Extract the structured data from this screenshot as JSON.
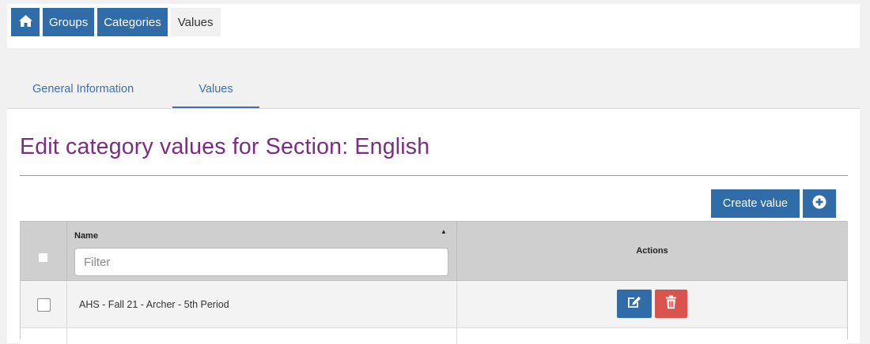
{
  "breadcrumb": {
    "home_icon": "home-icon",
    "items": [
      "Groups",
      "Categories"
    ],
    "current": "Values"
  },
  "tabs": [
    {
      "label": "General Information",
      "active": false
    },
    {
      "label": "Values",
      "active": true
    }
  ],
  "page_title": "Edit category values for Section: English",
  "toolbar": {
    "create_label": "Create value",
    "plus_icon": "plus-circle-icon"
  },
  "table": {
    "columns": {
      "name": "Name",
      "actions": "Actions"
    },
    "filter_placeholder": "Filter",
    "rows": [
      {
        "name": "AHS - Fall 21 - Archer - 5th Period"
      }
    ]
  },
  "colors": {
    "primary": "#2f6ca8",
    "danger": "#d9534f",
    "title": "#7a2d83",
    "tab": "#3f6faf"
  }
}
